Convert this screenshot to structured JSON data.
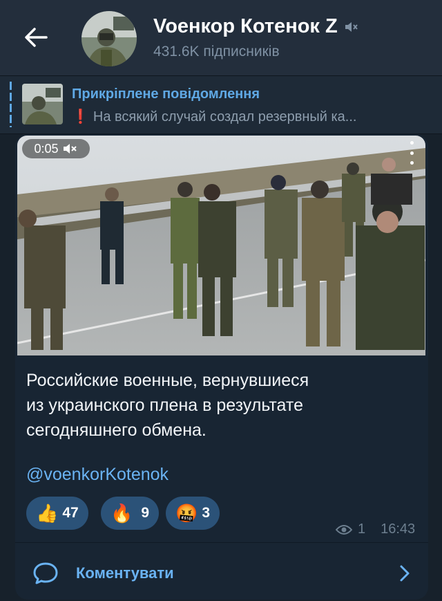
{
  "header": {
    "channel_title": "Voенкор Котенок Z",
    "subscribers": "431.6K підписників",
    "back_icon": "arrow-left-icon",
    "muted_icon": "muted-speaker-icon"
  },
  "pinned": {
    "title": "Прикріплене повідомлення",
    "excl": "❗",
    "text": "На всякий случай создал резервный ка..."
  },
  "message": {
    "video_duration": "0:05",
    "text_lines": [
      "Российские военные, вернувшиеся",
      "из украинского плена в результате",
      "сегодняшнего обмена."
    ],
    "link": "@voenkorKotenok",
    "reactions": [
      {
        "emoji": "👍",
        "count": "47"
      },
      {
        "emoji": "🔥",
        "count": "9"
      },
      {
        "emoji": "🤬",
        "count": "3"
      }
    ],
    "views": "1",
    "time": "16:43"
  },
  "comments": {
    "label": "Коментувати"
  },
  "colors": {
    "accent": "#6ab3f3",
    "header_bg": "#232e3c",
    "bubble_bg": "#182533",
    "reaction_bg": "#2b5278"
  }
}
